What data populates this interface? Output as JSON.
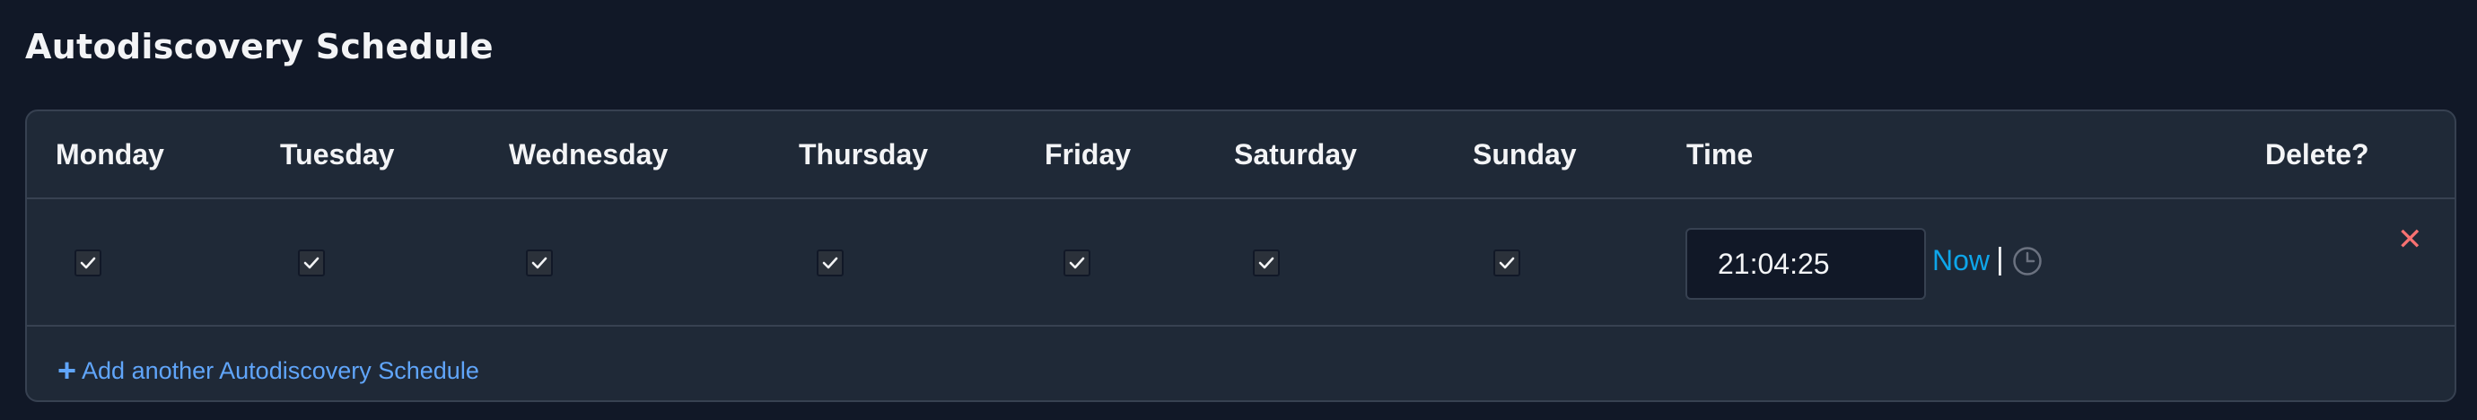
{
  "title": "Autodiscovery Schedule",
  "columns": {
    "monday": "Monday",
    "tuesday": "Tuesday",
    "wednesday": "Wednesday",
    "thursday": "Thursday",
    "friday": "Friday",
    "saturday": "Saturday",
    "sunday": "Sunday",
    "time": "Time",
    "delete": "Delete?"
  },
  "schedule": {
    "monday": true,
    "tuesday": true,
    "wednesday": true,
    "thursday": true,
    "friday": true,
    "saturday": true,
    "sunday": true,
    "time": "21:04:25",
    "now_label": "Now",
    "separator": "|",
    "clock_icon": "clock-icon",
    "delete_label": "✕"
  },
  "add_label": "Add another Autodiscovery Schedule",
  "colors": {
    "background": "#111827",
    "panel": "#1f2937",
    "link": "#60a5fa",
    "now_link": "#0ea5e9",
    "delete": "#f87171"
  }
}
